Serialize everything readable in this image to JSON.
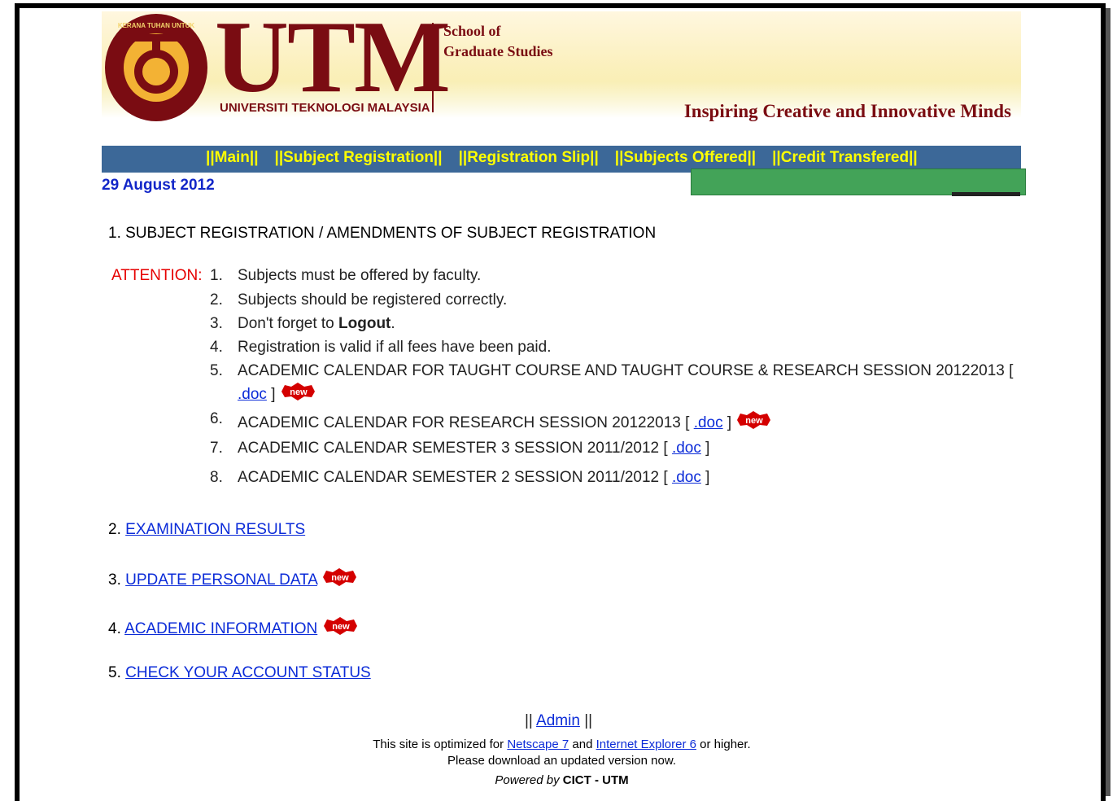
{
  "header": {
    "logo_text": "UTM",
    "logo_subtitle": "UNIVERSITI TEKNOLOGI MALAYSIA",
    "school_line1": "School of",
    "school_line2": "Graduate Studies",
    "tagline": "Inspiring Creative and Innovative Minds"
  },
  "nav": {
    "items": [
      "||Main||",
      "||Subject Registration||",
      "||Registration Slip||",
      "||Subjects Offered||",
      "||Credit Transfered||"
    ]
  },
  "date": "29 August 2012",
  "section1": {
    "title": "1. SUBJECT REGISTRATION / AMENDMENTS OF SUBJECT REGISTRATION",
    "attention_label": "ATTENTION:",
    "items": [
      {
        "num": "1.",
        "text": "Subjects must be offered by faculty."
      },
      {
        "num": "2.",
        "text": "Subjects should be registered correctly."
      },
      {
        "num": "3.",
        "text_before": "Don't forget to ",
        "bold": "Logout",
        "text_after": "."
      },
      {
        "num": "4.",
        "text": "Registration is valid if all fees have been paid."
      },
      {
        "num": "5.",
        "text": "ACADEMIC CALENDAR FOR TAUGHT COURSE AND TAUGHT COURSE & RESEARCH SESSION 20122013 [",
        "link": ".doc",
        "after": "]"
      },
      {
        "num": "6.",
        "text": "ACADEMIC CALENDAR FOR RESEARCH SESSION 20122013 [",
        "link": ".doc",
        "after": "]"
      },
      {
        "num": "7.",
        "text": "ACADEMIC CALENDAR SEMESTER 3 SESSION 2011/2012 [",
        "link": ".doc",
        "after": "]"
      },
      {
        "num": "8.",
        "text": "ACADEMIC CALENDAR SEMESTER 2 SESSION 2011/2012 [",
        "link": ".doc",
        "after": "]"
      }
    ]
  },
  "sections": {
    "s2_num": "2.",
    "s2_link": "EXAMINATION RESULTS",
    "s3_num": "3.",
    "s3_link": "UPDATE PERSONAL DATA",
    "s4_num": "4.",
    "s4_link": "ACADEMIC INFORMATION",
    "s5_num": "5.",
    "s5_link": "CHECK YOUR ACCOUNT STATUS"
  },
  "badges": {
    "new": "new"
  },
  "footer": {
    "admin_pre": "||",
    "admin_link": "Admin",
    "admin_post": "||",
    "opt_pre": "This site is optimized for ",
    "netscape": "Netscape 7",
    "opt_and": " and ",
    "ie": "Internet Explorer 6",
    "opt_post": " or higher.",
    "opt_line2": "Please download an updated version now.",
    "powered_pre": "Powered by ",
    "powered_org": "CICT - UTM"
  },
  "colors": {
    "brand": "#7a0c12",
    "nav_bg": "#3c6898",
    "nav_text": "#ffff00",
    "link": "#0b2bd8",
    "attention": "#e60000",
    "date": "#1226c8",
    "green_box": "#43a358"
  }
}
